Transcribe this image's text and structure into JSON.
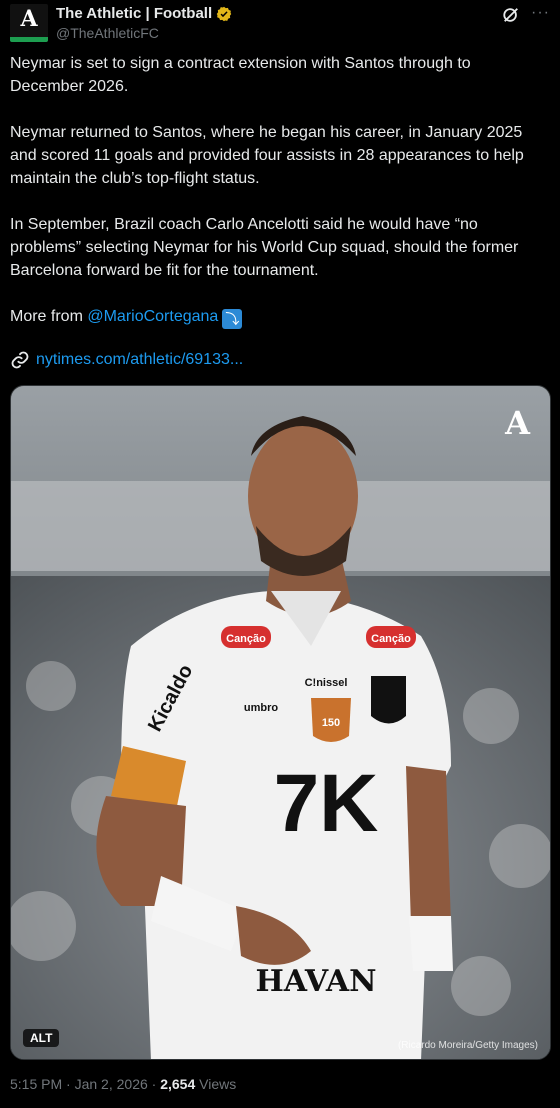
{
  "account": {
    "display_name": "The Athletic | Football",
    "handle": "@TheAthleticFC",
    "avatar_letter": "A",
    "verified_icon": "gold-verified-badge",
    "verified_color": "#e2b719",
    "avatar_bar_color": "#1d9e50"
  },
  "tweet": {
    "paragraphs": [
      "Neymar is set to sign a contract extension with Santos through to December 2026.",
      "Neymar returned to Santos, where he began his career, in January 2025 and scored 11 goals and provided four assists in 28 appearances to help maintain the club’s top-flight status.",
      "In September, Brazil coach Carlo Ancelotti said he would have “no problems” selecting Neymar for his World Cup squad, should the former Barcelona forward be fit for the tournament."
    ],
    "more_from_prefix": "More from ",
    "more_from_mention": "@MarioCortegana",
    "more_from_emoji": "⤵",
    "link_icon": "link-icon",
    "link_text": "nytimes.com/athletic/69133..."
  },
  "media": {
    "alt_label": "ALT",
    "credit": "(Ricardo Moreira/Getty Images)",
    "watermark": "A",
    "shirt_sponsor_top": "Canção",
    "shirt_brand": "umbro",
    "shirt_sponsor_chest": "7K",
    "shirt_sponsor_sleeve": "Kicaldo",
    "shirt_sponsor_bottom": "HAVAN",
    "shirt_sponsor_small": "C!nissel",
    "crest_label": "150"
  },
  "footer": {
    "time": "5:15 PM",
    "separator": " · ",
    "date": "Jan 2, 2026",
    "views_count": "2,654",
    "views_label": " Views"
  }
}
